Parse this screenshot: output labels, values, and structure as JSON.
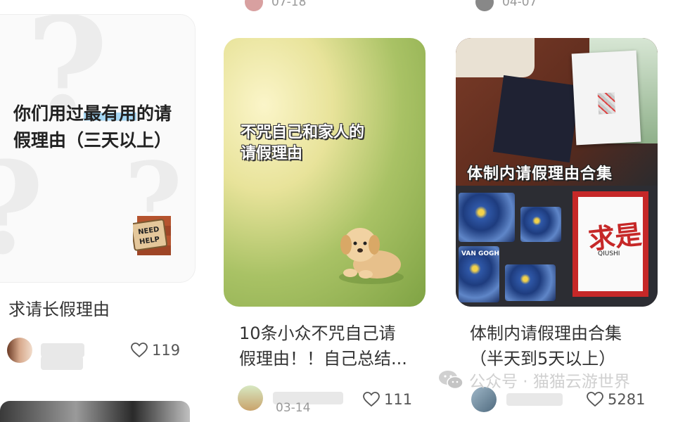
{
  "top_row": {
    "left_date": "07-18",
    "right_date": "04-07"
  },
  "cards": [
    {
      "cover_text_plain": "你们用过",
      "cover_text_highlight": "最有用",
      "cover_text_rest": "的请假理由（三天以上）",
      "sign_text_1": "NEED",
      "sign_text_2": "HELP",
      "title": "求请长假理由",
      "likes": "119"
    },
    {
      "cover_text_line1": "不咒自己和家人的",
      "cover_text_line2": "请假理由",
      "title_line1": "10条小众不咒自己请",
      "title_line2": "假理由！！自己总结...",
      "date": "03-14",
      "likes": "111"
    },
    {
      "cover_banner": "体制内请假理由合集",
      "book_title": "求是",
      "book_subtitle": "QIUSHI",
      "van_gogh_label": "VAN GOGH",
      "title_line1": "体制内请假理由合集",
      "title_line2": "（半天到5天以上）",
      "likes": "5281"
    }
  ],
  "watermark": {
    "text": "公众号 · 猫猫云游世界"
  },
  "colors": {
    "highlight": "#a6d8f5",
    "title_text": "#333333",
    "meta_text": "#555555"
  }
}
